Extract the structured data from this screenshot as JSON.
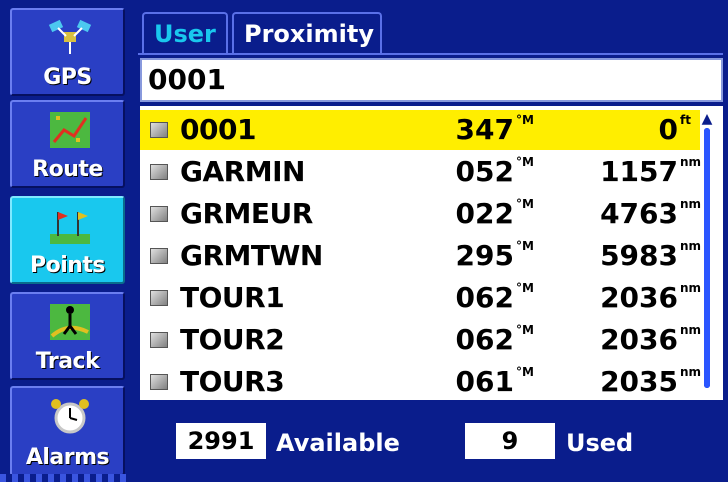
{
  "sidebar": {
    "items": [
      {
        "label": "GPS",
        "icon": "satellite-icon",
        "active": false
      },
      {
        "label": "Route",
        "icon": "route-icon",
        "active": false
      },
      {
        "label": "Points",
        "icon": "flags-icon",
        "active": true
      },
      {
        "label": "Track",
        "icon": "hiker-icon",
        "active": false
      },
      {
        "label": "Alarms",
        "icon": "alarm-clock-icon",
        "active": false
      }
    ]
  },
  "tabs": [
    {
      "label": "User",
      "active": true
    },
    {
      "label": "Proximity",
      "active": false
    }
  ],
  "search": {
    "value": "0001"
  },
  "waypoints": {
    "rows": [
      {
        "name": "0001",
        "bearing": "347",
        "bearing_unit": "°M",
        "distance": "0",
        "distance_unit": "ft",
        "selected": true
      },
      {
        "name": "GARMIN",
        "bearing": "052",
        "bearing_unit": "°M",
        "distance": "1157",
        "distance_unit": "nm",
        "selected": false
      },
      {
        "name": "GRMEUR",
        "bearing": "022",
        "bearing_unit": "°M",
        "distance": "4763",
        "distance_unit": "nm",
        "selected": false
      },
      {
        "name": "GRMTWN",
        "bearing": "295",
        "bearing_unit": "°M",
        "distance": "5983",
        "distance_unit": "nm",
        "selected": false
      },
      {
        "name": "TOUR1",
        "bearing": "062",
        "bearing_unit": "°M",
        "distance": "2036",
        "distance_unit": "nm",
        "selected": false
      },
      {
        "name": "TOUR2",
        "bearing": "062",
        "bearing_unit": "°M",
        "distance": "2036",
        "distance_unit": "nm",
        "selected": false
      },
      {
        "name": "TOUR3",
        "bearing": "061",
        "bearing_unit": "°M",
        "distance": "2035",
        "distance_unit": "nm",
        "selected": false
      }
    ]
  },
  "stats": {
    "available_count": "2991",
    "available_label": "Available",
    "used_count": "9",
    "used_label": "Used"
  },
  "colors": {
    "background": "#0a1d8c",
    "selected_row": "#ffee00",
    "active_tab_text": "#19c8ee",
    "active_sidebar": "#19c8ee"
  }
}
